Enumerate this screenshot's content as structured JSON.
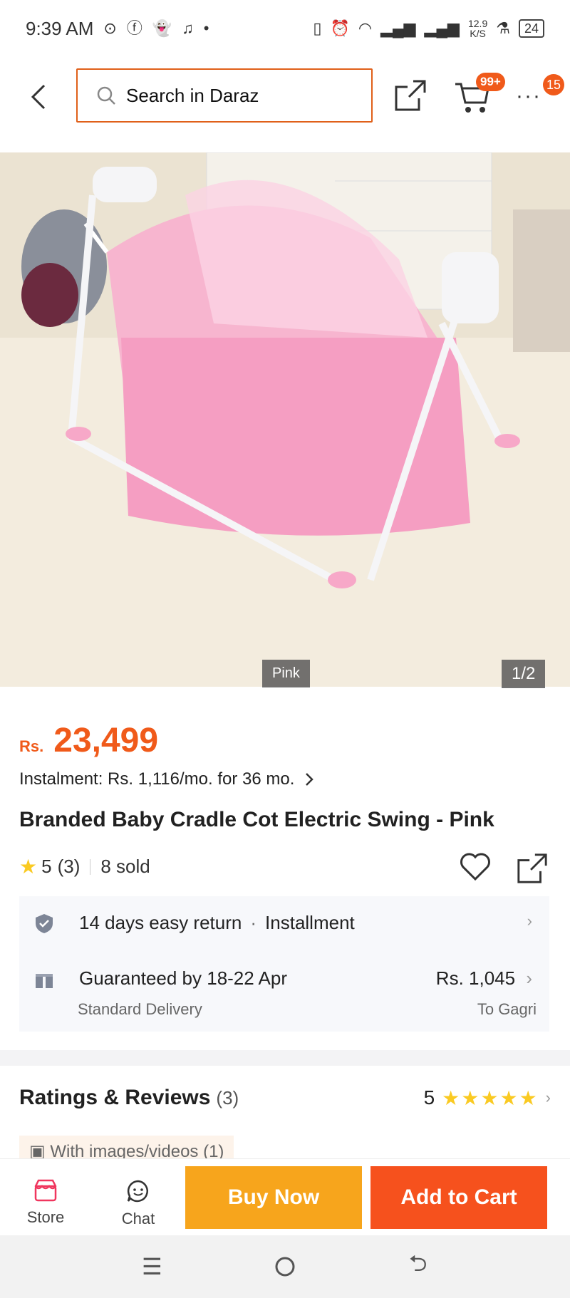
{
  "status_bar": {
    "time": "9:39 AM",
    "net_speed_top": "12.9",
    "net_speed_unit": "K/S",
    "battery": "24"
  },
  "nav": {
    "search_label": "Search in Daraz",
    "cart_badge": "99+",
    "more_badge": "15"
  },
  "product": {
    "variant_tag": "Pink",
    "image_counter": "1/2",
    "currency": "Rs.",
    "price": "23,499",
    "instalment": "Instalment: Rs. 1,116/mo. for 36 mo.",
    "title": "Branded Baby Cradle Cot Electric Swing - Pink",
    "rating": "5",
    "rating_count": "(3)",
    "sold": "8 sold"
  },
  "delivery": {
    "return_text": "14 days easy return",
    "installment_text": "Installment",
    "guarantee": "Guaranteed by 18-22 Apr",
    "delivery_type": "Standard Delivery",
    "fee": "Rs. 1,045",
    "destination": "To Gagri"
  },
  "ratings": {
    "title": "Ratings & Reviews",
    "count": "(3)",
    "score": "5",
    "stars": "★★★★★",
    "media_chip": "With images/videos (1)"
  },
  "actions": {
    "store_label": "Store",
    "chat_label": "Chat",
    "buy_now": "Buy Now",
    "add_to_cart": "Add to Cart"
  },
  "colors": {
    "accent": "#f05a1a",
    "buy_now": "#f7a51c",
    "add_to_cart": "#f6511d",
    "star": "#faca22"
  }
}
